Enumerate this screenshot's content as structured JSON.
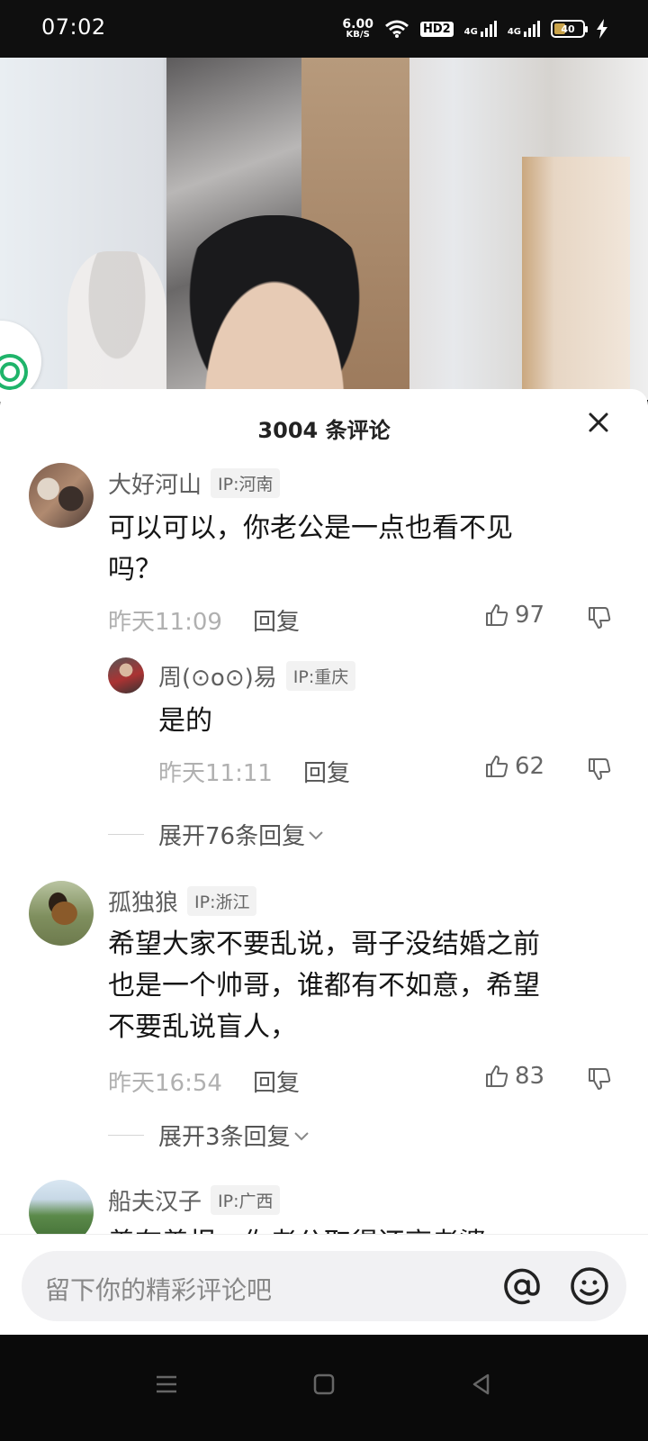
{
  "status_bar": {
    "time": "07:02",
    "speed_value": "6.00",
    "speed_unit": "KB/S",
    "hd_label": "HD2",
    "network_1": "4G",
    "network_2": "4G",
    "battery_level": 40
  },
  "comment_sheet": {
    "title": "3004 条评论",
    "close_icon": "close-icon"
  },
  "comments": [
    {
      "user": "大好河山",
      "ip": "IP:河南",
      "text_lines": [
        "可以可以，你老公是一点也看不见",
        "吗？"
      ],
      "time": "昨天11:09",
      "reply_label": "回复",
      "likes": "97",
      "replies": [
        {
          "user": "周(⊙o⊙)易",
          "ip": "IP:重庆",
          "text": "是的",
          "time": "昨天11:11",
          "reply_label": "回复",
          "likes": "62"
        }
      ],
      "expand_label": "展开76条回复"
    },
    {
      "user": "孤独狼",
      "ip": "IP:浙江",
      "text_lines": [
        "希望大家不要乱说，哥子没结婚之前",
        "也是一个帅哥，谁都有不如意，希望",
        "不要乱说盲人，"
      ],
      "time": "昨天16:54",
      "reply_label": "回复",
      "likes": "83",
      "expand_label": "展开3条回复"
    },
    {
      "user": "船夫汉子",
      "ip": "IP:广西",
      "text_lines": [
        "善有善报，你老公取得还高老婆"
      ]
    }
  ],
  "input_bar": {
    "placeholder": "留下你的精彩评论吧",
    "at_icon": "at-icon",
    "emoji_icon": "emoji-icon"
  },
  "colors": {
    "accent_green": "#1fb46a",
    "text_primary": "#151515",
    "text_secondary": "#5f5f5f",
    "meta_gray": "#b0b0b0"
  }
}
